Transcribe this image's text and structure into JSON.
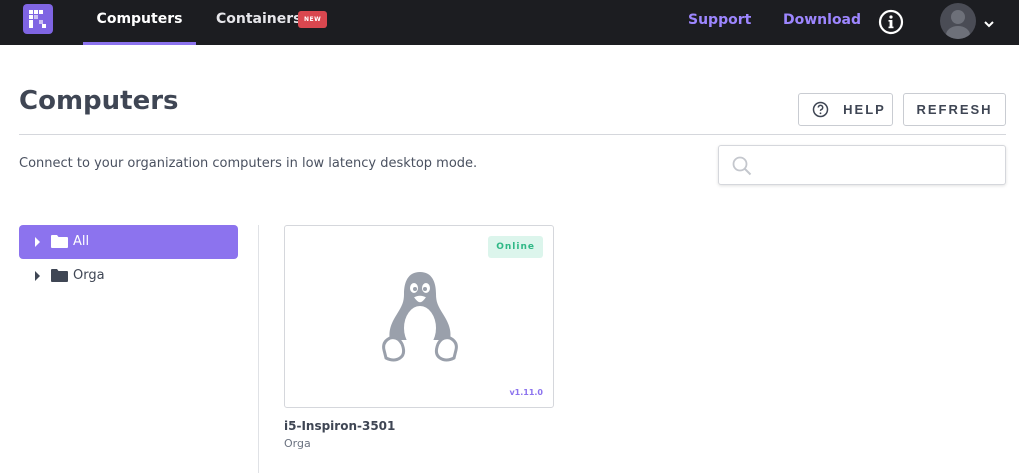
{
  "nav": {
    "tabs": [
      {
        "label": "Computers",
        "active": true
      },
      {
        "label": "Containers",
        "badge": "NEW"
      }
    ],
    "links": {
      "support": "Support",
      "download": "Download"
    },
    "icons": {
      "logo": "app-logo-icon",
      "info": "info-icon",
      "avatar": "user-avatar-icon",
      "menu": "chevron-down-icon"
    }
  },
  "header": {
    "title": "Computers",
    "help_label": "HELP",
    "refresh_label": "REFRESH",
    "subtitle": "Connect to your organization computers in low latency desktop mode."
  },
  "search": {
    "placeholder": "",
    "value": ""
  },
  "tree": [
    {
      "label": "All",
      "selected": true
    },
    {
      "label": "Orga",
      "selected": false
    }
  ],
  "computers": [
    {
      "name": "i5-Inspiron-3501",
      "group": "Orga",
      "status": "Online",
      "version": "v1.11.0",
      "os_icon": "linux-tux-icon"
    }
  ],
  "colors": {
    "accent": "#8c73ee",
    "topbar": "#1c1d21",
    "online": "#2fb886",
    "badge": "#d9474f"
  }
}
